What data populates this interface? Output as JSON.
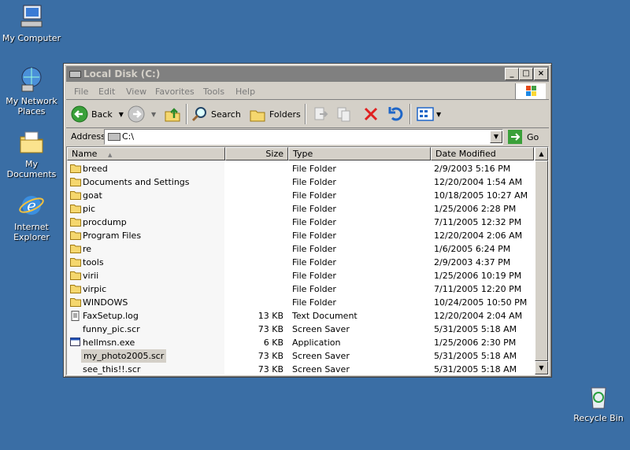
{
  "desktop": {
    "icons": [
      {
        "label": "My Computer"
      },
      {
        "label": "My Network Places"
      },
      {
        "label": "My Documents"
      },
      {
        "label": "Internet Explorer"
      },
      {
        "label": "Recycle Bin"
      }
    ]
  },
  "window": {
    "title": "Local Disk (C:)",
    "controls": {
      "minimize": "_",
      "maximize": "□",
      "close": "×"
    }
  },
  "menu": [
    "File",
    "Edit",
    "View",
    "Favorites",
    "Tools",
    "Help"
  ],
  "toolbar": {
    "back_label": "Back",
    "search_label": "Search",
    "folders_label": "Folders"
  },
  "address": {
    "label": "Address",
    "value": "C:\\",
    "go_label": "Go"
  },
  "columns": {
    "name": "Name",
    "size": "Size",
    "type": "Type",
    "date": "Date Modified"
  },
  "files": [
    {
      "name": "breed",
      "size": "",
      "type": "File Folder",
      "date": "2/9/2003 5:16 PM",
      "icon": "folder"
    },
    {
      "name": "Documents and Settings",
      "size": "",
      "type": "File Folder",
      "date": "12/20/2004 1:54 AM",
      "icon": "folder"
    },
    {
      "name": "goat",
      "size": "",
      "type": "File Folder",
      "date": "10/18/2005 10:27 AM",
      "icon": "folder"
    },
    {
      "name": "pic",
      "size": "",
      "type": "File Folder",
      "date": "1/25/2006 2:28 PM",
      "icon": "folder"
    },
    {
      "name": "procdump",
      "size": "",
      "type": "File Folder",
      "date": "7/11/2005 12:32 PM",
      "icon": "folder"
    },
    {
      "name": "Program Files",
      "size": "",
      "type": "File Folder",
      "date": "12/20/2004 2:06 AM",
      "icon": "folder"
    },
    {
      "name": "re",
      "size": "",
      "type": "File Folder",
      "date": "1/6/2005 6:24 PM",
      "icon": "folder"
    },
    {
      "name": "tools",
      "size": "",
      "type": "File Folder",
      "date": "2/9/2003 4:37 PM",
      "icon": "folder"
    },
    {
      "name": "virii",
      "size": "",
      "type": "File Folder",
      "date": "1/25/2006 10:19 PM",
      "icon": "folder"
    },
    {
      "name": "virpic",
      "size": "",
      "type": "File Folder",
      "date": "7/11/2005 12:20 PM",
      "icon": "folder"
    },
    {
      "name": "WINDOWS",
      "size": "",
      "type": "File Folder",
      "date": "10/24/2005 10:50 PM",
      "icon": "folder"
    },
    {
      "name": "FaxSetup.log",
      "size": "13 KB",
      "type": "Text Document",
      "date": "12/20/2004 2:04 AM",
      "icon": "text"
    },
    {
      "name": "funny_pic.scr",
      "size": "73 KB",
      "type": "Screen Saver",
      "date": "5/31/2005 5:18 AM",
      "icon": "none"
    },
    {
      "name": "hellmsn.exe",
      "size": "6 KB",
      "type": "Application",
      "date": "1/25/2006 2:30 PM",
      "icon": "app"
    },
    {
      "name": "my_photo2005.scr",
      "size": "73 KB",
      "type": "Screen Saver",
      "date": "5/31/2005 5:18 AM",
      "icon": "none",
      "selected": true
    },
    {
      "name": "see_this!!.scr",
      "size": "73 KB",
      "type": "Screen Saver",
      "date": "5/31/2005 5:18 AM",
      "icon": "none"
    }
  ],
  "colors": {
    "desktop": "#3a6ea5",
    "chrome": "#d4d0c8",
    "titlebar_inactive": "#808080"
  }
}
